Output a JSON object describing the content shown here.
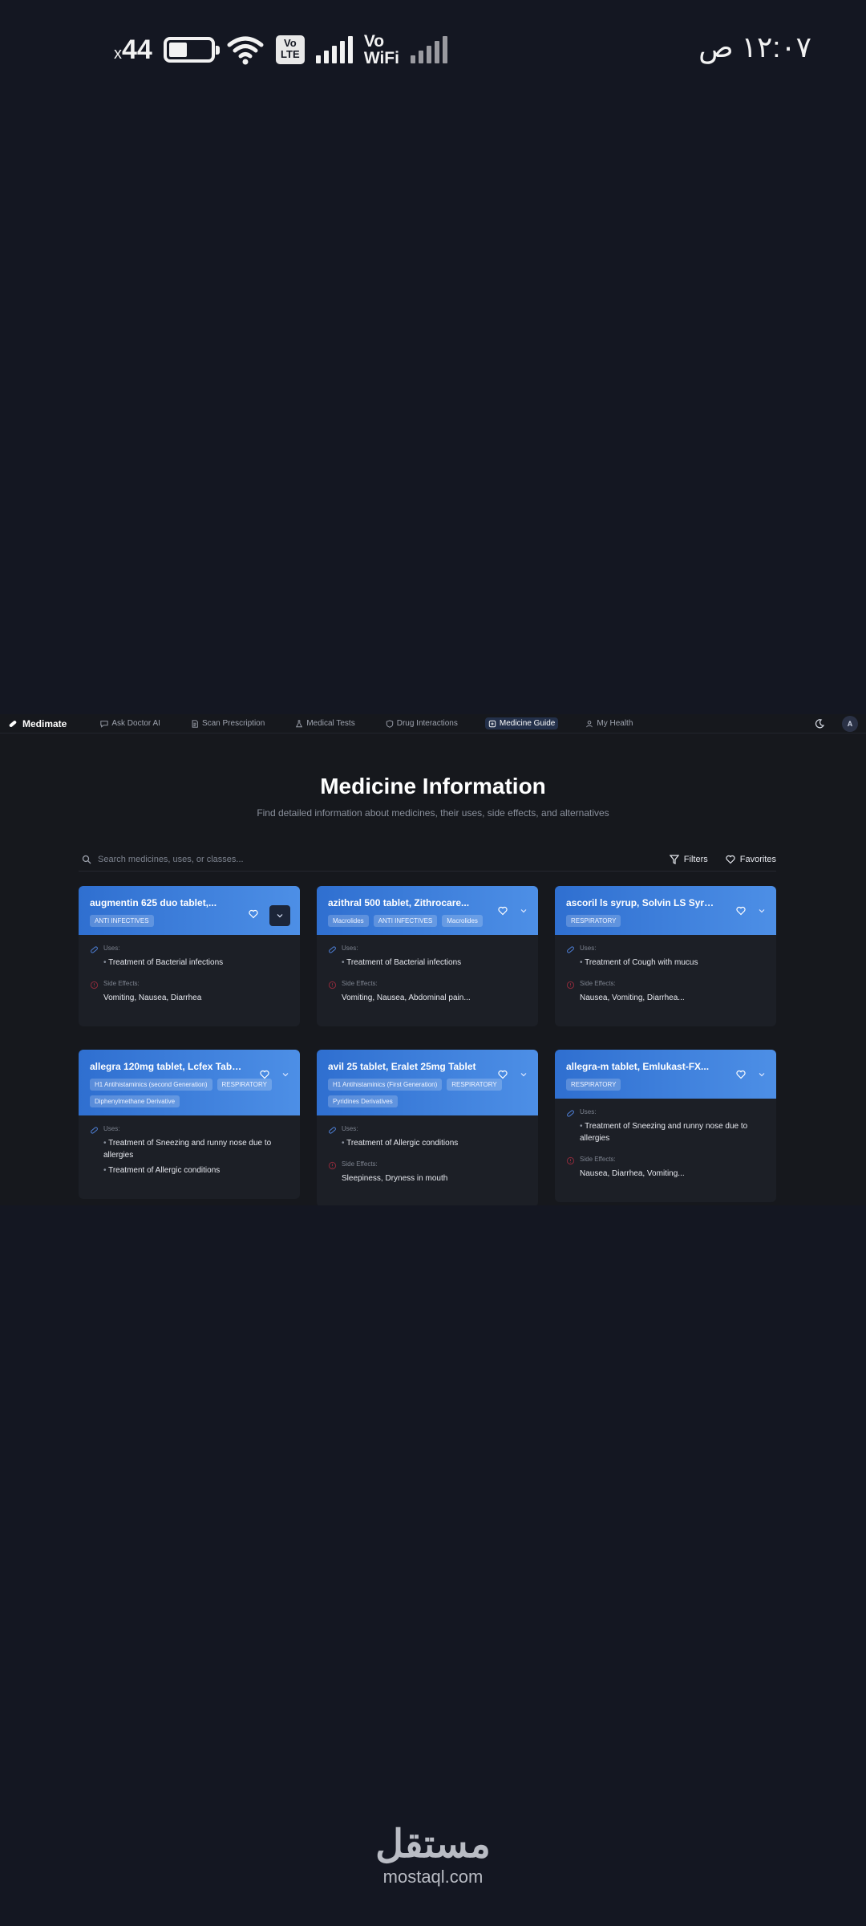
{
  "status_bar": {
    "battery_level": "44",
    "battery_prefix": "x",
    "battery_fraction": 0.44,
    "vo_label": "Vo",
    "lte_label": "Vo\nLTE",
    "wifi_label": "WiFi",
    "time": "١٢:٠٧ ص"
  },
  "app": {
    "brand": "Medimate",
    "nav": [
      {
        "label": "Ask Doctor AI",
        "icon": "chat-icon"
      },
      {
        "label": "Scan Prescription",
        "icon": "document-icon"
      },
      {
        "label": "Medical Tests",
        "icon": "flask-icon"
      },
      {
        "label": "Drug Interactions",
        "icon": "shield-icon"
      },
      {
        "label": "Medicine Guide",
        "icon": "pill-icon",
        "active": true
      },
      {
        "label": "My Health",
        "icon": "user-icon"
      }
    ],
    "avatar": "A",
    "page_title": "Medicine Information",
    "page_subtitle": "Find detailed information about medicines, their uses, side effects, and alternatives",
    "search_placeholder": "Search medicines, uses, or classes...",
    "filters_label": "Filters",
    "favorites_label": "Favorites",
    "uses_label": "Uses:",
    "side_effects_label": "Side Effects:",
    "cards": [
      {
        "title": "augmentin 625 duo tablet,...",
        "tags": [
          "ANTI INFECTIVES"
        ],
        "uses": [
          "Treatment of Bacterial infections"
        ],
        "side_effects": "Vomiting, Nausea, Diarrhea",
        "side_label": "Side Effects:"
      },
      {
        "title": "azithral 500 tablet, Zithrocare...",
        "tags": [
          "Macrolides",
          "ANTI INFECTIVES",
          "Macrolides"
        ],
        "uses": [
          "Treatment of Bacterial infections"
        ],
        "side_effects": "Vomiting, Nausea, Abdominal pain...",
        "side_label": "Side Effects:"
      },
      {
        "title": "ascoril ls syrup, Solvin LS Syrup,...",
        "tags": [
          "RESPIRATORY"
        ],
        "uses": [
          "Treatment of Cough with mucus"
        ],
        "side_effects": "Nausea, Vomiting, Diarrhea...",
        "side_label": "Side Effects:"
      },
      {
        "title": "allegra 120mg tablet, Lcfex Tablet...",
        "tags": [
          "H1 Antihistaminics (second Generation)",
          "RESPIRATORY",
          "Diphenylmethane Derivative"
        ],
        "uses": [
          "Treatment of Sneezing and runny nose due to allergies",
          "Treatment of Allergic conditions"
        ],
        "side_effects": "",
        "side_label": ""
      },
      {
        "title": "avil 25 tablet, Eralet 25mg Tablet",
        "tags": [
          "H1 Antihistaminics (First Generation)",
          "RESPIRATORY",
          "Pyridines Derivatives"
        ],
        "uses": [
          "Treatment of Allergic conditions"
        ],
        "side_effects": "Sleepiness, Dryness in mouth",
        "side_label": "Side Effects:"
      },
      {
        "title": "allegra-m tablet, Emlukast-FX...",
        "tags": [
          "RESPIRATORY"
        ],
        "uses": [
          "Treatment of Sneezing and runny nose due to allergies"
        ],
        "side_effects": "Nausea, Diarrhea, Vomiting...",
        "side_label": "Side Effects:"
      }
    ]
  },
  "watermark": {
    "arabic": "مستقل",
    "latin": "mostaql.com"
  },
  "colors": {
    "background": "#141722",
    "card_header_start": "#2f6fd0",
    "card_header_end": "#4d8fe6",
    "card_body": "#1c1f26"
  }
}
